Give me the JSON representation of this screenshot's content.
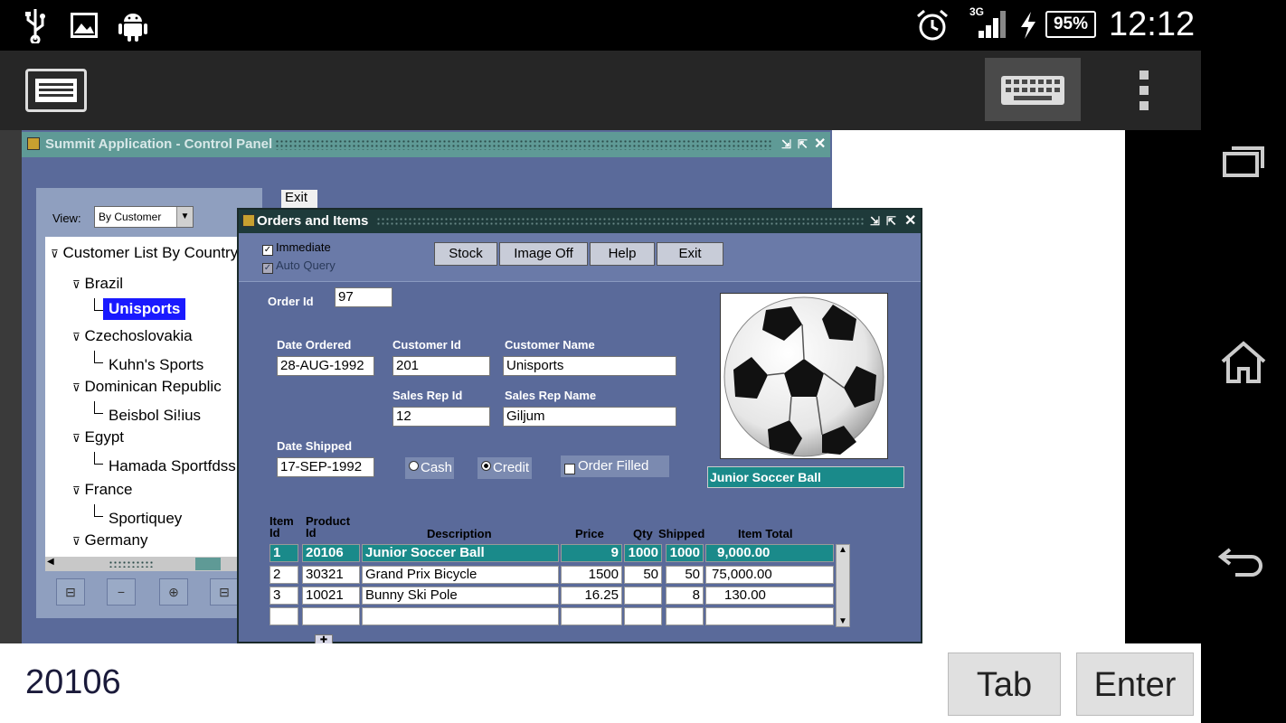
{
  "status_bar": {
    "network": "3G",
    "battery": "95%",
    "time": "12:12"
  },
  "control_panel": {
    "title": "Summit Application - Control Panel",
    "view_label": "View:",
    "view_value": "By Customer",
    "exit_label": "Exit",
    "tree_root": "Customer List By Country",
    "tree": [
      {
        "country": "Brazil",
        "customer": "Unisports"
      },
      {
        "country": "Czechoslovakia",
        "customer": "Kuhn's Sports"
      },
      {
        "country": "Dominican Republic",
        "customer": "Beisbol Si!ius"
      },
      {
        "country": "Egypt",
        "customer": "Hamada Sportfdss"
      },
      {
        "country": "France",
        "customer": "Sportiquey"
      },
      {
        "country": "Germany",
        "customer": ""
      }
    ]
  },
  "orders": {
    "title": "Orders and Items",
    "immediate_label": "Immediate",
    "auto_query_label": "Auto Query",
    "buttons": {
      "stock": "Stock",
      "image_off": "Image Off",
      "help": "Help",
      "exit": "Exit"
    },
    "order_id_label": "Order Id",
    "order_id": "97",
    "date_ordered_label": "Date Ordered",
    "date_ordered": "28-AUG-1992",
    "customer_id_label": "Customer Id",
    "customer_id": "201",
    "customer_name_label": "Customer Name",
    "customer_name": "Unisports",
    "sales_rep_id_label": "Sales Rep Id",
    "sales_rep_id": "12",
    "sales_rep_name_label": "Sales Rep Name",
    "sales_rep_name": "Giljum",
    "date_shipped_label": "Date Shipped",
    "date_shipped": "17-SEP-1992",
    "cash_label": "Cash",
    "credit_label": "Credit",
    "order_filled_label": "Order Filled",
    "image_caption": "Junior Soccer Ball",
    "columns": {
      "item_id": [
        "Item",
        "Id"
      ],
      "product_id": [
        "Product",
        "Id"
      ],
      "description": "Description",
      "price": "Price",
      "qty": "Qty",
      "shipped": "Shipped",
      "item_total": "Item Total"
    },
    "rows": [
      {
        "item_id": "1",
        "product_id": "20106",
        "description": "Junior Soccer Ball",
        "price": "9",
        "qty": "1000",
        "shipped": "1000",
        "item_total": "9,000.00"
      },
      {
        "item_id": "2",
        "product_id": "30321",
        "description": "Grand Prix Bicycle",
        "price": "1500",
        "qty": "50",
        "shipped": "50",
        "item_total": "75,000.00"
      },
      {
        "item_id": "3",
        "product_id": "10021",
        "description": "Bunny Ski Pole",
        "price": "16.25",
        "qty": "",
        "shipped": "8",
        "item_total": "130.00"
      },
      {
        "item_id": "",
        "product_id": "",
        "description": "",
        "price": "",
        "qty": "",
        "shipped": "",
        "item_total": ""
      }
    ]
  },
  "bottom": {
    "entry_value": "20106",
    "tab_label": "Tab",
    "enter_label": "Enter"
  },
  "icons": [
    "usb-icon",
    "image-icon",
    "android-icon",
    "alarm-icon",
    "signal-icon",
    "charging-icon",
    "remote-desktop-icon",
    "keyboard-icon",
    "overflow-menu-icon",
    "recent-apps-icon",
    "home-icon",
    "back-icon",
    "soccer-ball-icon"
  ]
}
